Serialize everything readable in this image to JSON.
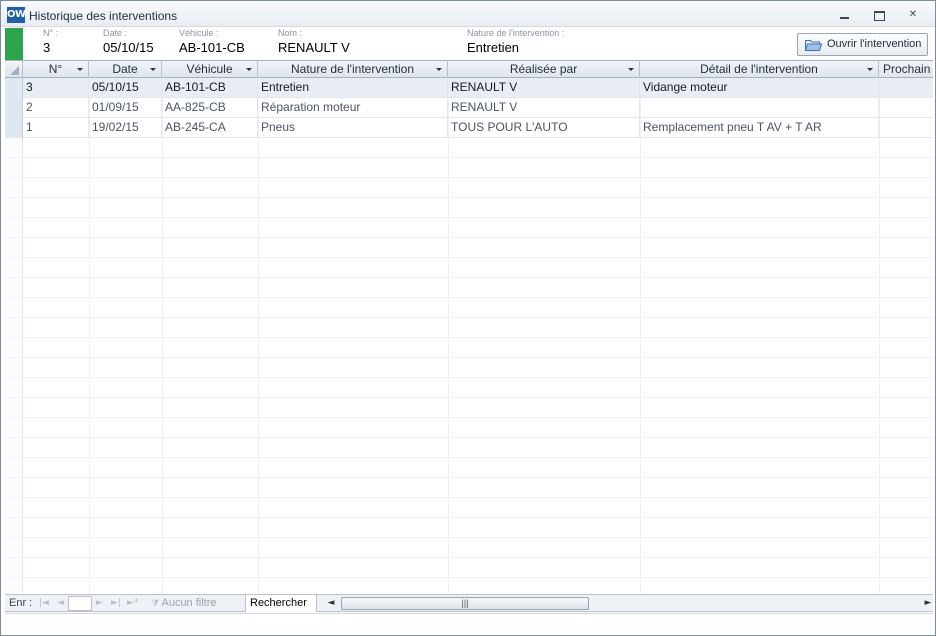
{
  "window": {
    "title": "Historique des interventions",
    "logo": "OW",
    "controls": [
      "minimize-icon",
      "maximize-icon",
      "close-icon"
    ]
  },
  "header": {
    "fields": [
      {
        "label": "N° :",
        "value": "3"
      },
      {
        "label": "Date :",
        "value": "05/10/15"
      },
      {
        "label": "Véhicule :",
        "value": "AB-101-CB"
      },
      {
        "label": "Nom :",
        "value": "RENAULT V"
      },
      {
        "label": "Nature de l'intervention :",
        "value": "Entretien"
      }
    ],
    "open_button": "Ouvrir l'intervention",
    "accent_color": "#2ca44a"
  },
  "table": {
    "columns": [
      "N°",
      "Date",
      "Véhicule",
      "Nature de l'intervention",
      "Réalisée par",
      "Détail de l'intervention",
      "Prochain"
    ],
    "rows": [
      [
        "3",
        "05/10/15",
        "AB-101-CB",
        "Entretien",
        "RENAULT V",
        "Vidange moteur",
        ""
      ],
      [
        "2",
        "01/09/15",
        "AA-825-CB",
        "Réparation moteur",
        "RENAULT V",
        "",
        ""
      ],
      [
        "1",
        "19/02/15",
        "AB-245-CA",
        "Pneus",
        "TOUS POUR L'AUTO",
        "Remplacement pneu T AV + T AR",
        ""
      ]
    ]
  },
  "navigation": {
    "record_label": "Enr :",
    "first": "|◄",
    "prev": "◄",
    "next": "►",
    "last": "►|",
    "new": "►*",
    "filter": "Aucun filtre",
    "search": "Rechercher",
    "scroll_left": "◄",
    "scroll_thumb": "|||",
    "scroll_right": "►"
  }
}
